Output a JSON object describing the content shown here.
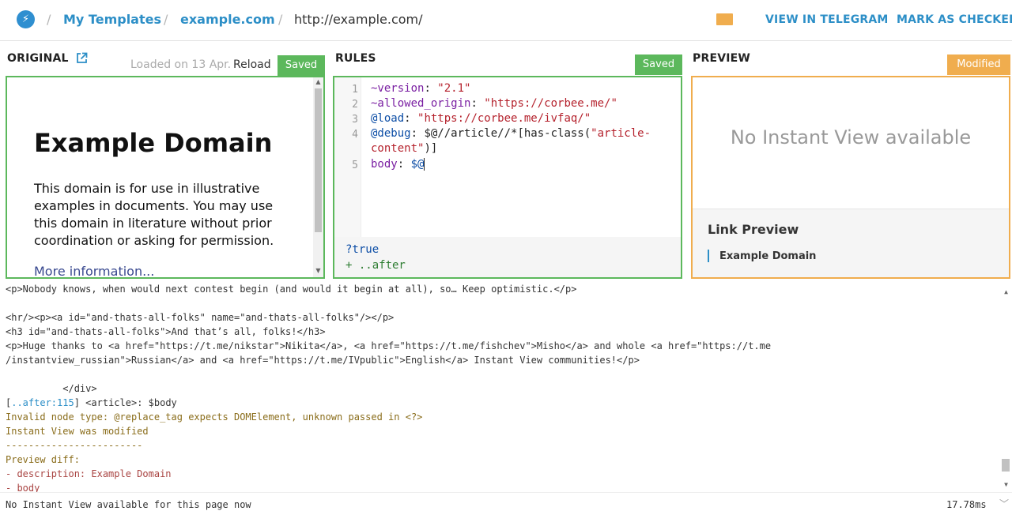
{
  "header": {
    "breadcrumb": {
      "separator": "/",
      "templates": "My Templates",
      "domain": "example.com",
      "url": "http://example.com/"
    },
    "view_in_telegram": "VIEW IN TELEGRAM",
    "mark_as_checked": "MARK AS CHECKED"
  },
  "original": {
    "title": "ORIGINAL",
    "loaded_text": "Loaded on 13 Apr.",
    "reload": "Reload",
    "status": "Saved",
    "page": {
      "heading": "Example Domain",
      "description": "This domain is for use in illustrative examples in documents. You may use this domain in literature without prior coordination or asking for permission.",
      "link": "More information..."
    }
  },
  "rules": {
    "title": "RULES",
    "status": "Saved",
    "lines": [
      {
        "num": "1",
        "key": "~version",
        "sep": ": ",
        "value": "\"2.1\""
      },
      {
        "num": "2",
        "key": "~allowed_origin",
        "sep": ": ",
        "value": "\"https://corbee.me/\""
      },
      {
        "num": "3",
        "key": "@load",
        "sep": ": ",
        "value": "\"https://corbee.me/ivfaq/\""
      },
      {
        "num": "4",
        "key": "@debug",
        "sep": ": ",
        "value": "$@//article//*[has-class(",
        "value2": "\"article-",
        "value3": "content\"",
        "value4": ")]"
      },
      {
        "num": "5",
        "key": "body",
        "sep": ": ",
        "value": "$@"
      }
    ],
    "footer": [
      "?true",
      "+ ..after"
    ]
  },
  "preview": {
    "title": "PREVIEW",
    "status": "Modified",
    "no_iv": "No Instant View available",
    "link_preview_title": "Link Preview",
    "link_preview_text": "Example Domain"
  },
  "log": {
    "lines": [
      {
        "text": "<p>Nobody knows, when would next contest begin (and would it begin at all), so… Keep optimistic.</p>",
        "kind": "normal"
      },
      {
        "text": "",
        "kind": "normal"
      },
      {
        "text": "<hr/><p><a id=\"and-thats-all-folks\" name=\"and-thats-all-folks\"/></p>",
        "kind": "normal"
      },
      {
        "text": "<h3 id=\"and-thats-all-folks\">And that’s all, folks!</h3>",
        "kind": "normal"
      },
      {
        "text": "<p>Huge thanks to <a href=\"https://t.me/nikstar\">Nikita</a>, <a href=\"https://t.me/fishchev\">Misho</a> and whole <a href=\"https://t.me",
        "kind": "normal"
      },
      {
        "text": "/instantview_russian\">Russian</a> and <a href=\"https://t.me/IVpublic\">English</a> Instant View communities!</p>",
        "kind": "normal"
      },
      {
        "text": "",
        "kind": "normal"
      },
      {
        "text": "          </div>",
        "kind": "normal"
      },
      {
        "text": "] <article>: $body",
        "kind": "normal",
        "prefix": "[",
        "link": "..after:115"
      },
      {
        "text": "Invalid node type: @replace_tag expects DOMElement, unknown passed in <?>",
        "kind": "warn"
      },
      {
        "text": "Instant View was modified",
        "kind": "warn"
      },
      {
        "text": "------------------------",
        "kind": "warn"
      },
      {
        "text": "Preview diff:",
        "kind": "warn"
      },
      {
        "text": "- description: Example Domain",
        "kind": "del"
      },
      {
        "text": "- body",
        "kind": "del"
      }
    ]
  },
  "footer": {
    "message": "No Instant View available for this page now",
    "time": "17.78ms"
  },
  "colors": {
    "accent": "#2d8fc7",
    "saved": "#5cb85c",
    "modified": "#f0ad4e"
  }
}
